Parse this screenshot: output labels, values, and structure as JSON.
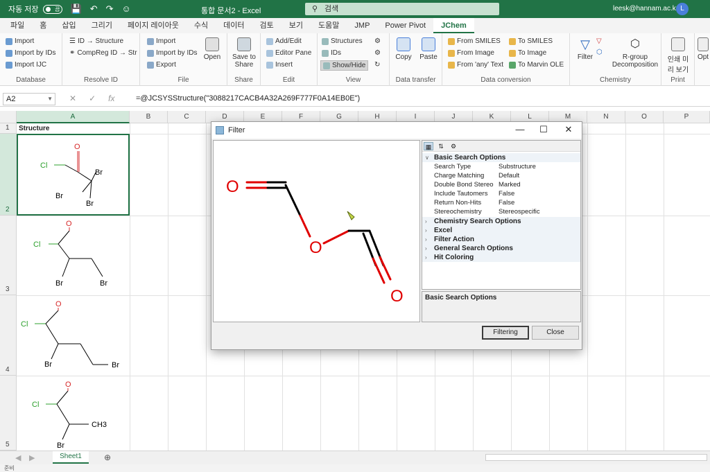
{
  "titlebar": {
    "autosave_label": "자동 저장",
    "autosave_state": "끔",
    "doc_title": "통합 문서2 - Excel",
    "search_placeholder": "검색",
    "user_email": "leesk@hannam.ac.kr",
    "avatar_letter": "L"
  },
  "tabs": [
    "파일",
    "홈",
    "삽입",
    "그리기",
    "페이지 레이아웃",
    "수식",
    "데이터",
    "검토",
    "보기",
    "도움말",
    "JMP",
    "Power Pivot",
    "JChem"
  ],
  "active_tab": "JChem",
  "ribbon": {
    "database": {
      "label": "Database",
      "items": [
        "Import",
        "Import by IDs",
        "Import IJC"
      ]
    },
    "resolve": {
      "label": "Resolve ID",
      "items": [
        "ID → Structure",
        "CompReg ID → Str"
      ]
    },
    "file": {
      "label": "File",
      "items": [
        "Import",
        "Import by IDs",
        "Export"
      ],
      "open": "Open"
    },
    "share": {
      "label": "Share",
      "btn1": "Save to",
      "btn2": "Share"
    },
    "edit": {
      "label": "Edit",
      "items": [
        "Add/Edit",
        "Editor Pane",
        "Insert"
      ]
    },
    "view": {
      "label": "View",
      "items": [
        "Structures",
        "IDs",
        "Show/Hide"
      ]
    },
    "transfer": {
      "label": "Data transfer",
      "copy": "Copy",
      "paste": "Paste"
    },
    "conversion": {
      "label": "Data conversion",
      "left": [
        "From SMILES",
        "From Image",
        "From 'any' Text"
      ],
      "right": [
        "To SMILES",
        "To Image",
        "To Marvin OLE"
      ]
    },
    "chemistry": {
      "label": "Chemistry",
      "filter": "Filter",
      "rgroup1": "R-group",
      "rgroup2": "Decomposition"
    },
    "print": {
      "label": "Print",
      "btn1": "인쇄 미",
      "btn2": "리 보기"
    },
    "extra": "Opt"
  },
  "formula_bar": {
    "cell_ref": "A2",
    "formula": "=@JCSYSStructure(\"3088217CACB4A32A269F777F0A14EB0E\")"
  },
  "columns": [
    "A",
    "B",
    "C",
    "D",
    "E",
    "F",
    "G",
    "H",
    "I",
    "J",
    "K",
    "L",
    "M",
    "N",
    "O",
    "P"
  ],
  "rows": [
    "1",
    "2",
    "3",
    "4",
    "5"
  ],
  "header_cell": "Structure",
  "molecules": [
    {
      "atoms": [
        "O",
        "Cl",
        "Br",
        "Br",
        "Br"
      ]
    },
    {
      "atoms": [
        "O",
        "Cl",
        "Br",
        "Br"
      ]
    },
    {
      "atoms": [
        "O",
        "Cl",
        "Br",
        "Br"
      ]
    },
    {
      "atoms": [
        "O",
        "Cl",
        "CH3",
        "Br"
      ]
    }
  ],
  "sheet_tab": "Sheet1",
  "status": "준비",
  "dialog": {
    "title": "Filter",
    "query_atoms": [
      "O",
      "O",
      "O"
    ],
    "categories_open": {
      "name": "Basic Search Options",
      "props": [
        {
          "k": "Search Type",
          "v": "Substructure"
        },
        {
          "k": "Charge Matching",
          "v": "Default"
        },
        {
          "k": "Double Bond Stereo",
          "v": "Marked"
        },
        {
          "k": "Include Tautomers",
          "v": "False"
        },
        {
          "k": "Return Non-Hits",
          "v": "False"
        },
        {
          "k": "Stereochemistry",
          "v": "Stereospecific"
        }
      ]
    },
    "categories_closed": [
      "Chemistry Search Options",
      "Excel",
      "Filter Action",
      "General Search Options",
      "Hit Coloring"
    ],
    "description": "Basic Search Options",
    "filter_btn": "Filtering",
    "close_btn": "Close"
  }
}
